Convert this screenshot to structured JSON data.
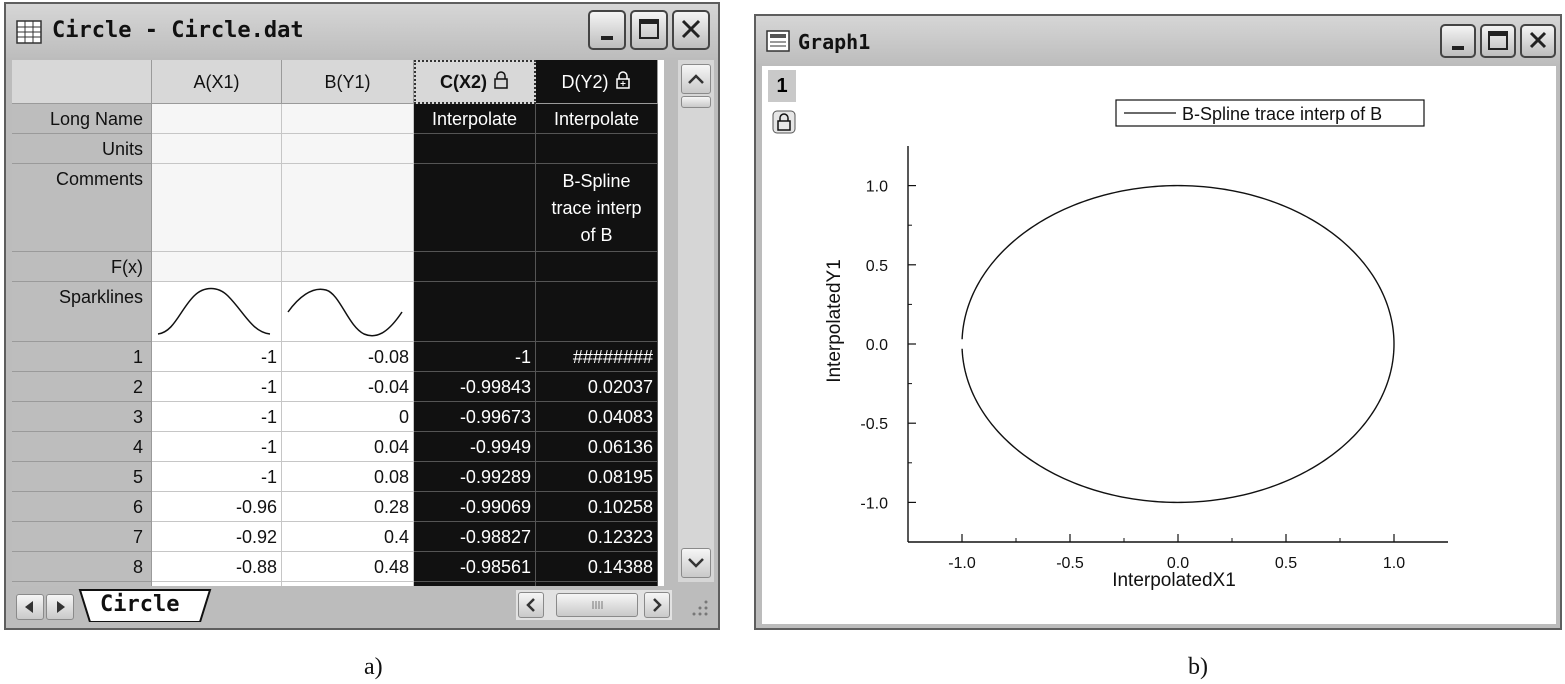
{
  "worksheet": {
    "title": "Circle - Circle.dat",
    "columns": [
      {
        "label": "A(X1)",
        "long_name": "",
        "units": "",
        "comments": "",
        "fx": ""
      },
      {
        "label": "B(Y1)",
        "long_name": "",
        "units": "",
        "comments": "",
        "fx": ""
      },
      {
        "label": "C(X2)",
        "long_name": "Interpolate",
        "units": "",
        "comments": "",
        "fx": ""
      },
      {
        "label": "D(Y2)",
        "long_name": "Interpolate",
        "units": "",
        "comments": "B-Spline trace interp of B",
        "fx": ""
      }
    ],
    "row_labels": {
      "long_name": "Long Name",
      "units": "Units",
      "comments": "Comments",
      "fx": "F(x)",
      "sparklines": "Sparklines"
    },
    "rows": [
      {
        "n": "1",
        "a": "-1",
        "b": "-0.08",
        "c": "-1",
        "d": "########"
      },
      {
        "n": "2",
        "a": "-1",
        "b": "-0.04",
        "c": "-0.99843",
        "d": "0.02037"
      },
      {
        "n": "3",
        "a": "-1",
        "b": "0",
        "c": "-0.99673",
        "d": "0.04083"
      },
      {
        "n": "4",
        "a": "-1",
        "b": "0.04",
        "c": "-0.9949",
        "d": "0.06136"
      },
      {
        "n": "5",
        "a": "-1",
        "b": "0.08",
        "c": "-0.99289",
        "d": "0.08195"
      },
      {
        "n": "6",
        "a": "-0.96",
        "b": "0.28",
        "c": "-0.99069",
        "d": "0.10258"
      },
      {
        "n": "7",
        "a": "-0.92",
        "b": "0.4",
        "c": "-0.98827",
        "d": "0.12323"
      },
      {
        "n": "8",
        "a": "-0.88",
        "b": "0.48",
        "c": "-0.98561",
        "d": "0.14388"
      }
    ],
    "sheet_tab": "Circle"
  },
  "graph": {
    "title": "Graph1",
    "layer_number": "1",
    "legend_text": "B-Spline trace interp of B",
    "chart_data": {
      "type": "line",
      "series": [
        {
          "name": "B-Spline trace interp of B",
          "shape": "ellipse",
          "x_center": 0,
          "y_center": 0,
          "x_radius": 1.0,
          "y_radius": 1.0
        }
      ],
      "xlabel": "InterpolatedX1",
      "ylabel": "InterpolatedY1",
      "xlim": [
        -1.25,
        1.25
      ],
      "ylim": [
        -1.25,
        1.25
      ],
      "xticks": [
        "-1.0",
        "-0.5",
        "0.0",
        "0.5",
        "1.0"
      ],
      "yticks": [
        "1.0",
        "0.5",
        "0.0",
        "-0.5",
        "-1.0"
      ],
      "legend_position": "top-right",
      "grid": false
    }
  },
  "captions": {
    "left": "a)",
    "right": "b)"
  },
  "colors": {
    "selected_column_bg": "#111111",
    "window_frame": "#bcbcbc"
  }
}
